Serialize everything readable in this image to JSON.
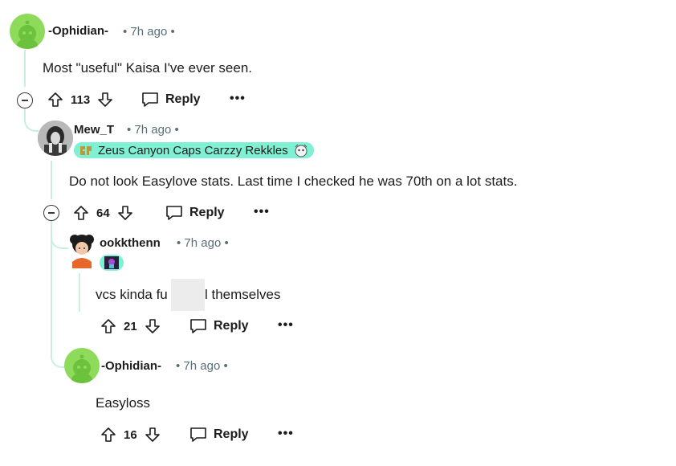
{
  "comments": [
    {
      "username": "-Ophidian-",
      "dot_time": "• 7h ago •",
      "body": "Most \"useful\" Kaisa I've ever seen.",
      "votes": "113",
      "reply_label": "Reply",
      "more": "•••"
    },
    {
      "username": "Mew_T",
      "dot_time": "• 7h ago •",
      "flair": "Zeus Canyon Caps Carzzy Rekkles",
      "body": "Do not look Easylove stats. Last time I checked he was 70th on a lot stats.",
      "votes": "64",
      "reply_label": "Reply",
      "more": "•••"
    },
    {
      "username": "ookkthenn",
      "dot_time": "• 7h ago •",
      "body_pre": "vcs kinda fu",
      "body_post": "l themselves",
      "votes": "21",
      "reply_label": "Reply",
      "more": "•••"
    },
    {
      "username": "-Ophidian-",
      "dot_time": "• 7h ago •",
      "body": "Easyloss",
      "votes": "16",
      "reply_label": "Reply",
      "more": "•••"
    }
  ],
  "colors": {
    "thread_line": "#c8f0dc",
    "flair_bg": "#7ff0d4",
    "snoo_bg": "#8edb5c",
    "meta": "#576f76"
  }
}
